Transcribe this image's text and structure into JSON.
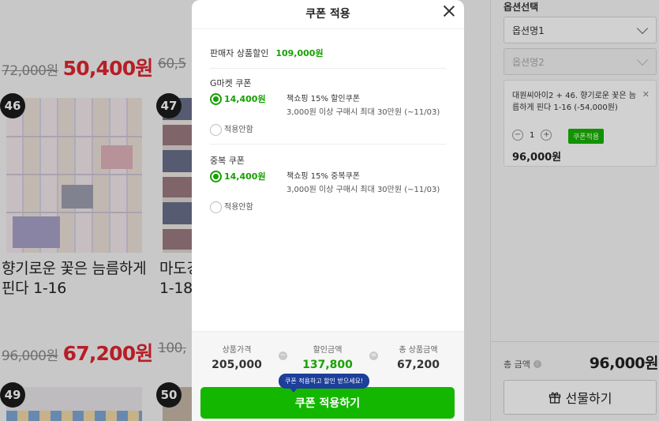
{
  "background": {
    "products": [
      {
        "old_price": "72,000원",
        "sale_price": "50,400원"
      },
      {
        "old_price": "60,5",
        "sale_price": ""
      }
    ],
    "items": [
      {
        "badge": "46",
        "title_line1": "향기로운 꽃은 늠름하게",
        "title_line2": "핀다 1-16",
        "old_price": "96,000원",
        "sale_price": "67,200원"
      },
      {
        "badge": "47",
        "title_line1": "마도경",
        "title_line2": "1-18",
        "old_price": "100,",
        "sale_price": ""
      }
    ],
    "next_badges": [
      "49",
      "50"
    ]
  },
  "sidebar": {
    "option_label": "옵션선택",
    "option1": "옵션명1",
    "option2": "옵션명2",
    "selected_item": {
      "description": "대원씨아이2 + 46. 향기로운 꽃은 늠름하게 핀다 1-16 (-54,000원)",
      "quantity": "1",
      "coupon_label": "쿠폰적용",
      "price": "96,000원"
    },
    "total_label": "총 금액",
    "total_value": "96,000원",
    "gift_label": "선물하기"
  },
  "modal": {
    "title": "쿠폰 적용",
    "seller_discount_label": "판매자 상품할인",
    "seller_discount_amount": "109,000원",
    "gmarket": {
      "title": "G마켓 쿠폰",
      "amount": "14,400원",
      "coupon_name": "책쇼핑 15% 할인쿠폰",
      "coupon_cond": "3,000원 이상 구매시 최대 30만원 (~11/03)",
      "none_label": "적용안함"
    },
    "duplicate": {
      "title": "중복 쿠폰",
      "amount": "14,400원",
      "coupon_name": "책쇼핑 15% 중복쿠폰",
      "coupon_cond": "3,000원 이상 구매시 최대 30만원 (~11/03)",
      "none_label": "적용안함"
    },
    "summary": {
      "product_price_label": "상품가격",
      "product_price": "205,000",
      "discount_label": "할인금액",
      "discount": "137,800",
      "total_label": "총 상품금액",
      "total": "67,200",
      "minus_symbol": "−",
      "equals_symbol": "="
    },
    "tooltip": "쿠폰 적용하고 할인 받으세요!",
    "apply_button": "쿠폰 적용하기"
  },
  "colors": {
    "accent": "#16a200",
    "sale_red": "#e0252f",
    "tooltip_blue": "#1d3f9a"
  }
}
